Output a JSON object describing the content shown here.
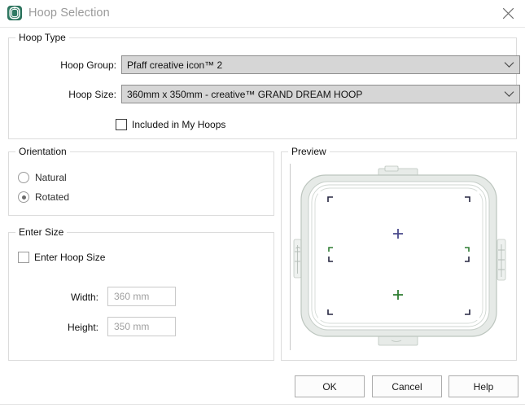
{
  "window": {
    "title": "Hoop Selection",
    "icon": "hoop-icon",
    "close_icon": "close-icon"
  },
  "hoop_type": {
    "legend": "Hoop Type",
    "hoop_group": {
      "label": "Hoop Group:",
      "value": "Pfaff creative icon™ 2",
      "chevron_icon": "chevron-down-icon"
    },
    "hoop_size": {
      "label": "Hoop Size:",
      "value": "360mm x 350mm - creative™ GRAND DREAM HOOP",
      "chevron_icon": "chevron-down-icon"
    },
    "included_in_my_hoops": {
      "label": "Included in My Hoops",
      "checked": false
    }
  },
  "orientation": {
    "legend": "Orientation",
    "options": [
      {
        "label": "Natural",
        "selected": false
      },
      {
        "label": "Rotated",
        "selected": true
      }
    ]
  },
  "enter_size": {
    "legend": "Enter Size",
    "enter_hoop_size": {
      "label": "Enter Hoop Size",
      "checked": false
    },
    "width": {
      "label": "Width:",
      "value": "360 mm",
      "placeholder": "360 mm",
      "enabled": false
    },
    "height": {
      "label": "Height:",
      "value": "350 mm",
      "placeholder": "350 mm",
      "enabled": false
    }
  },
  "preview": {
    "legend": "Preview",
    "graphic": "embroidery-hoop-illustration",
    "frame_color": "#dfe5e0",
    "frame_outline": "#b9c2bb",
    "marker_colors": {
      "origin_marker": "#4a4a8c",
      "secondary_marker": "#2e7d32",
      "corner_bracket": "#262640",
      "corner_bracket_alt": "#2e7d32"
    }
  },
  "buttons": {
    "ok": "OK",
    "cancel": "Cancel",
    "help": "Help"
  }
}
